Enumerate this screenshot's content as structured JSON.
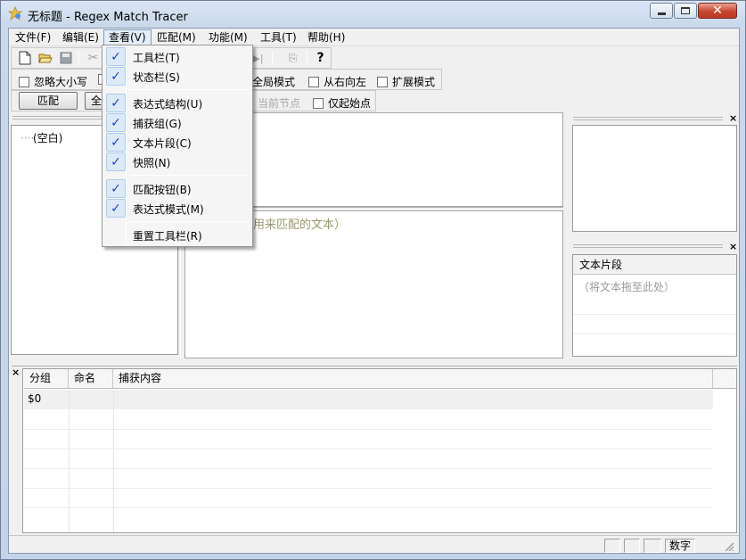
{
  "window": {
    "title": "无标题 - Regex Match Tracer"
  },
  "menubar": {
    "items": [
      "文件(F)",
      "编辑(E)",
      "查看(V)",
      "匹配(M)",
      "功能(M)",
      "工具(T)",
      "帮助(H)"
    ]
  },
  "options_bar": {
    "ignore_case": "忽略大小写",
    "global_mode": "全局模式",
    "right_to_left": "从右向左",
    "extended_mode": "扩展模式"
  },
  "match_bar": {
    "match_button": "匹配",
    "all_button_partial": "全",
    "current_node": "当前节点",
    "start_only": "仅起始点"
  },
  "tree": {
    "root_label": "(空白)"
  },
  "text_area": {
    "hint_partial": "用来匹配的文本）"
  },
  "snippets": {
    "header": "文本片段",
    "placeholder": "（将文本拖至此处）"
  },
  "results": {
    "columns": [
      "分组",
      "命名",
      "捕获内容"
    ],
    "rows": [
      {
        "group": "$0",
        "name": "",
        "content": ""
      }
    ]
  },
  "statusbar": {
    "numlock": "数字"
  },
  "view_menu": {
    "items": [
      {
        "label": "工具栏(T)",
        "checked": true
      },
      {
        "label": "状态栏(S)",
        "checked": true
      },
      {
        "label": "表达式结构(U)",
        "checked": true
      },
      {
        "label": "捕获组(G)",
        "checked": true
      },
      {
        "label": "文本片段(C)",
        "checked": true
      },
      {
        "label": "快照(N)",
        "checked": true
      },
      {
        "label": "匹配按钮(B)",
        "checked": true
      },
      {
        "label": "表达式模式(M)",
        "checked": true
      },
      {
        "label": "重置工具栏(R)",
        "checked": false
      }
    ]
  }
}
